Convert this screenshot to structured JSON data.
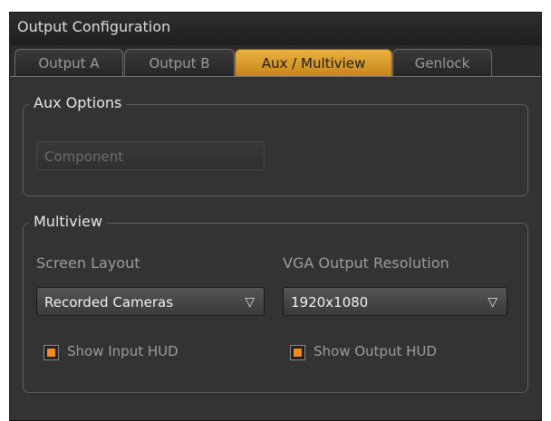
{
  "window": {
    "title": "Output Configuration"
  },
  "tabs": [
    {
      "label": "Output A",
      "active": false
    },
    {
      "label": "Output B",
      "active": false
    },
    {
      "label": "Aux / Multiview",
      "active": true
    },
    {
      "label": "Genlock",
      "active": false
    }
  ],
  "aux_options": {
    "title": "Aux Options",
    "source_button": {
      "label": "Component",
      "enabled": false
    }
  },
  "multiview": {
    "title": "Multiview",
    "screen_layout": {
      "label": "Screen Layout",
      "value": "Recorded Cameras"
    },
    "vga_resolution": {
      "label": "VGA Output Resolution",
      "value": "1920x1080"
    },
    "show_input_hud": {
      "label": "Show Input HUD",
      "checked": true
    },
    "show_output_hud": {
      "label": "Show Output HUD",
      "checked": true
    }
  },
  "colors": {
    "active_tab": "#e0a235",
    "check_fill": "#f28a1e",
    "panel_bg": "#333333"
  },
  "icons": {
    "dropdown": "triangle-down-outline-icon"
  }
}
